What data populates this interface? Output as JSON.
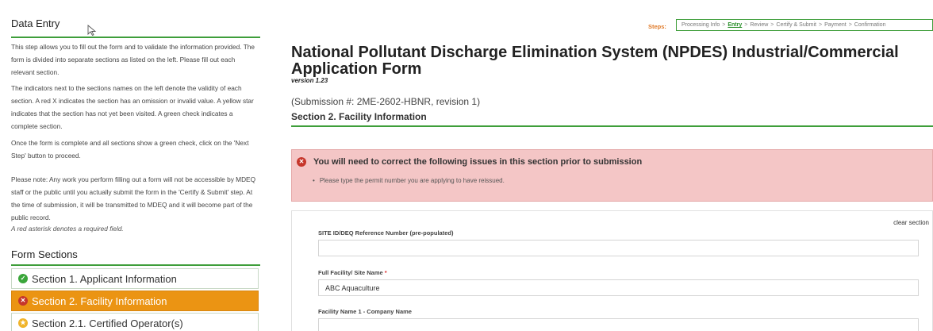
{
  "sidebar": {
    "title": "Data Entry",
    "paragraphs": [
      "This step allows you to fill out the form and to validate the information provided. The form is divided into separate sections as listed on the left. Please fill out each relevant section.",
      "The indicators next to the sections names on the left denote the validity of each section. A red X indicates the section has an omission or invalid value. A yellow star indicates that the section has not yet been visited. A green check indicates a complete section.",
      "Once the form is complete and all sections show a green check, click on the 'Next Step' button to proceed.",
      "Please note: Any work you perform filling out a form will not be accessible by MDEQ staff or the public until you actually submit the form in the 'Certify & Submit' step. At the time of submission, it will be transmitted to MDEQ and it will become part of the public record.",
      "A red asterisk denotes a required field."
    ],
    "form_sections_title": "Form Sections",
    "sections": [
      {
        "label": "Section 1. Applicant Information",
        "status": "complete",
        "icon": "check-icon"
      },
      {
        "label": "Section 2. Facility Information",
        "status": "invalid",
        "icon": "x-icon"
      },
      {
        "label": "Section 2.1. Certified Operator(s)",
        "status": "not-visited",
        "icon": "star-icon"
      }
    ]
  },
  "steps": {
    "label": "Steps:",
    "items": [
      "Processing Info",
      "Entry",
      "Review",
      "Certify & Submit",
      "Payment",
      "Confirmation"
    ],
    "current": "Entry",
    "separator": ">"
  },
  "main": {
    "title": "National Pollutant Discharge Elimination System (NPDES) Industrial/Commercial Application Form",
    "version": "version 1.23",
    "submission": "(Submission #: 2ME-2602-HBNR, revision 1)",
    "section_title": "Section 2. Facility Information"
  },
  "error": {
    "heading": "You will need to correct the following issues in this section prior to submission",
    "items": [
      "Please type the permit number you are applying to have reissued."
    ]
  },
  "form": {
    "clear_label": "clear section",
    "fields": [
      {
        "label": "SITE ID/DEQ Reference Number (pre-populated)",
        "value": "",
        "required": false
      },
      {
        "label": "Full Facility/ Site Name",
        "value": "ABC Aquaculture",
        "required": true
      },
      {
        "label": "Facility Name 1 - Company Name",
        "value": "",
        "required": false
      }
    ],
    "required_mark": "*"
  },
  "colors": {
    "accent_green": "#3e9e3a",
    "active_orange": "#eb9413",
    "error_bg": "#f4c6c6",
    "steps_label": "#e07b2a"
  }
}
